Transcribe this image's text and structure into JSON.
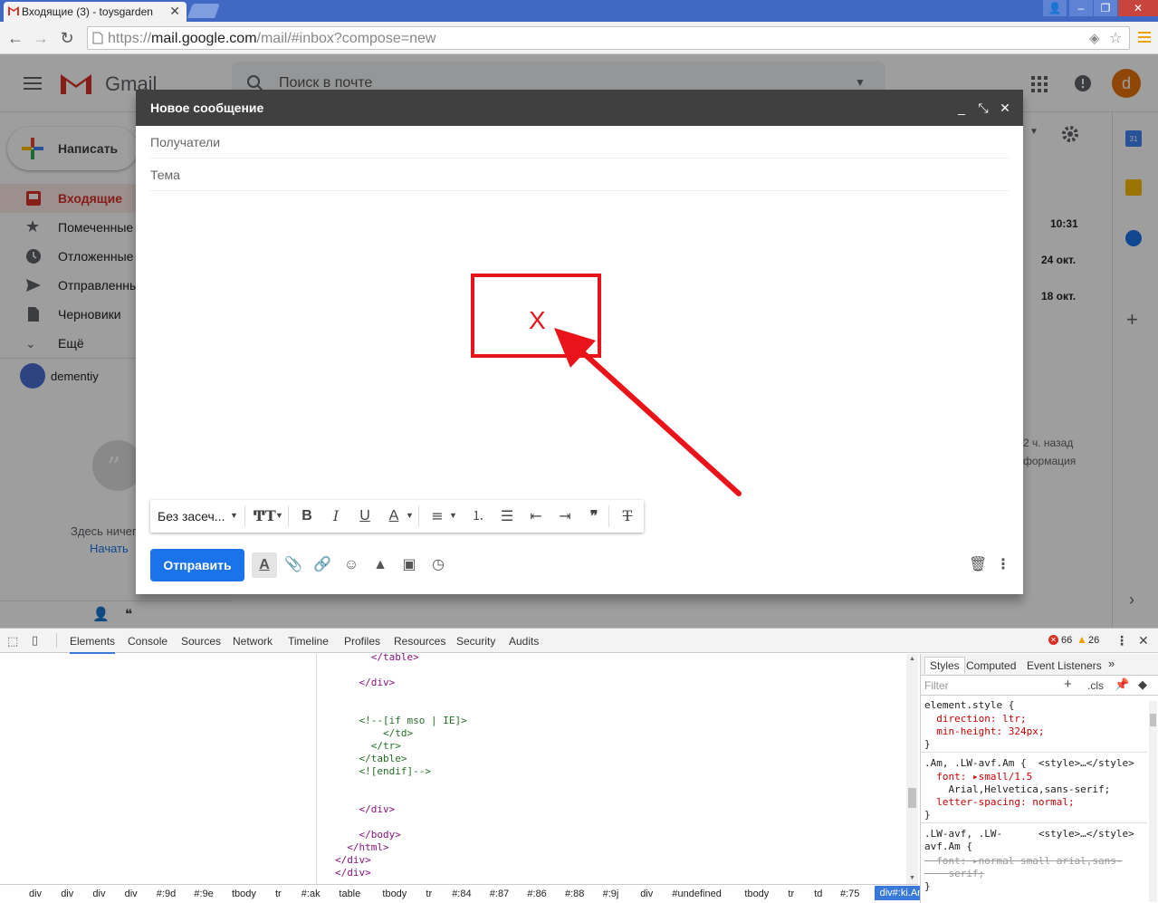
{
  "browser": {
    "tab_title": "Входящие (3) - toysgarden",
    "url_scheme": "https://",
    "url_host": "mail.google.com",
    "url_path": "/mail/#inbox?compose=new"
  },
  "gmail": {
    "logo_text": "Gmail",
    "search_placeholder": "Поиск в почте",
    "avatar_letter": "d",
    "compose_label": "Написать",
    "nav": [
      {
        "label": "Входящие"
      },
      {
        "label": "Помеченные"
      },
      {
        "label": "Отложенные"
      },
      {
        "label": "Отправленные"
      },
      {
        "label": "Черновики"
      },
      {
        "label": "Ещё"
      }
    ],
    "account_name": "dementiy",
    "empty_text": "Здесь ничего",
    "empty_link": "Начать",
    "mail_dates": [
      "10:31",
      "24 окт.",
      "18 окт."
    ],
    "activity_line1": "2 ч. назад",
    "activity_line2": "формация",
    "calendar_badge": "31"
  },
  "compose": {
    "title": "Новое сообщение",
    "to_placeholder": "Получатели",
    "subject_placeholder": "Тема",
    "font_name": "Без засеч...",
    "send_label": "Отправить",
    "annotation_mark": "X"
  },
  "devtools": {
    "tabs": [
      "Elements",
      "Console",
      "Sources",
      "Network",
      "Timeline",
      "Profiles",
      "Resources",
      "Security",
      "Audits"
    ],
    "errors": "66",
    "warnings": "26",
    "code": [
      "      </table>",
      "",
      "    </div>",
      "",
      "",
      "    <!--[if mso | IE]>",
      "        </td>",
      "      </tr>",
      "    </table>",
      "    <![endif]-->",
      "",
      "",
      "    </div>",
      "",
      "    </body>",
      "  </html>",
      "</div>",
      "</div>"
    ],
    "crumbs": [
      "div",
      "div",
      "div",
      "div",
      "#:9d",
      "#:9e",
      "tbody",
      "tr",
      "#:ak",
      "table",
      "tbody",
      "tr",
      "#:84",
      "#:87",
      "#:86",
      "#:88",
      "#:9j",
      "div",
      "#undefined",
      "tbody",
      "tr",
      "td",
      "#:75"
    ],
    "crumb_active": "div#:ki.Am.Al.editable.LW-avf",
    "styles_tabs": [
      "Styles",
      "Computed",
      "Event Listeners"
    ],
    "filter_placeholder": "Filter",
    "cls_label": ".cls",
    "rules": [
      "element.style {",
      "  direction: ltr;",
      "  min-height: 324px;",
      "}",
      ".Am, .LW-avf.Am {  <style>…</style>",
      "  font: ▸small/1.5",
      "    Arial,Helvetica,sans-serif;",
      "  letter-spacing: normal;",
      "}",
      ".LW-avf, .LW-      <style>…</style>",
      "avf.Am {",
      "  font: ▸normal small arial,sans-",
      "    serif;",
      "}"
    ]
  }
}
